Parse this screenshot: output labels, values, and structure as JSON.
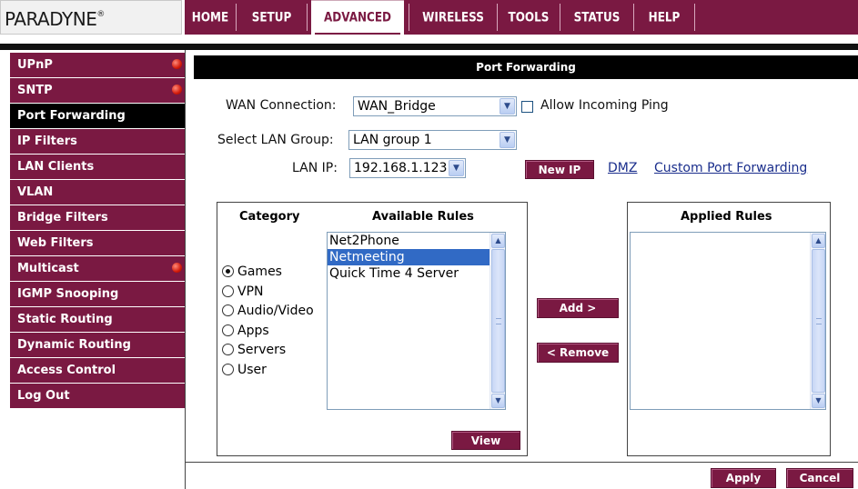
{
  "brand": {
    "logo_text": "PARADYNE",
    "logo_mark": "®"
  },
  "nav": {
    "tabs": [
      {
        "label": "HOME"
      },
      {
        "label": "SETUP"
      },
      {
        "label": "ADVANCED",
        "active": true
      },
      {
        "label": "WIRELESS"
      },
      {
        "label": "TOOLS"
      },
      {
        "label": "STATUS"
      },
      {
        "label": "HELP"
      }
    ]
  },
  "sidebar": {
    "items": [
      {
        "label": "UPnP",
        "indicator": true
      },
      {
        "label": "SNTP",
        "indicator": true
      },
      {
        "label": "Port Forwarding",
        "active": true
      },
      {
        "label": "IP Filters"
      },
      {
        "label": "LAN Clients"
      },
      {
        "label": "VLAN"
      },
      {
        "label": "Bridge Filters"
      },
      {
        "label": "Web Filters"
      },
      {
        "label": "Multicast",
        "indicator": true
      },
      {
        "label": "IGMP Snooping"
      },
      {
        "label": "Static Routing"
      },
      {
        "label": "Dynamic Routing"
      },
      {
        "label": "Access Control"
      },
      {
        "label": "Log Out"
      }
    ]
  },
  "panel": {
    "title": "Port Forwarding"
  },
  "form": {
    "wan_label": "WAN Connection:",
    "wan_value": "WAN_Bridge",
    "allow_ping_label": "Allow Incoming Ping",
    "allow_ping_checked": false,
    "lan_group_label": "Select LAN Group:",
    "lan_group_value": "LAN group 1",
    "lan_ip_label": "LAN IP:",
    "lan_ip_value": "192.168.1.123",
    "new_ip_button": "New IP",
    "dmz_link": "DMZ",
    "custom_link": "Custom Port Forwarding"
  },
  "rules": {
    "category_header": "Category",
    "available_header": "Available Rules",
    "applied_header": "Applied Rules",
    "categories": [
      {
        "label": "Games",
        "selected": true
      },
      {
        "label": "VPN"
      },
      {
        "label": "Audio/Video"
      },
      {
        "label": "Apps"
      },
      {
        "label": "Servers"
      },
      {
        "label": "User"
      }
    ],
    "available": [
      {
        "label": "Net2Phone"
      },
      {
        "label": "Netmeeting",
        "selected": true
      },
      {
        "label": "Quick Time 4 Server"
      }
    ],
    "applied": [],
    "add_button": "Add >",
    "remove_button": "< Remove",
    "view_button": "View"
  },
  "actions": {
    "apply": "Apply",
    "cancel": "Cancel"
  },
  "colors": {
    "brand": "#7a1942",
    "selection": "#316ac5",
    "link": "#1a2e8c",
    "indicator": "#d21a0a"
  }
}
